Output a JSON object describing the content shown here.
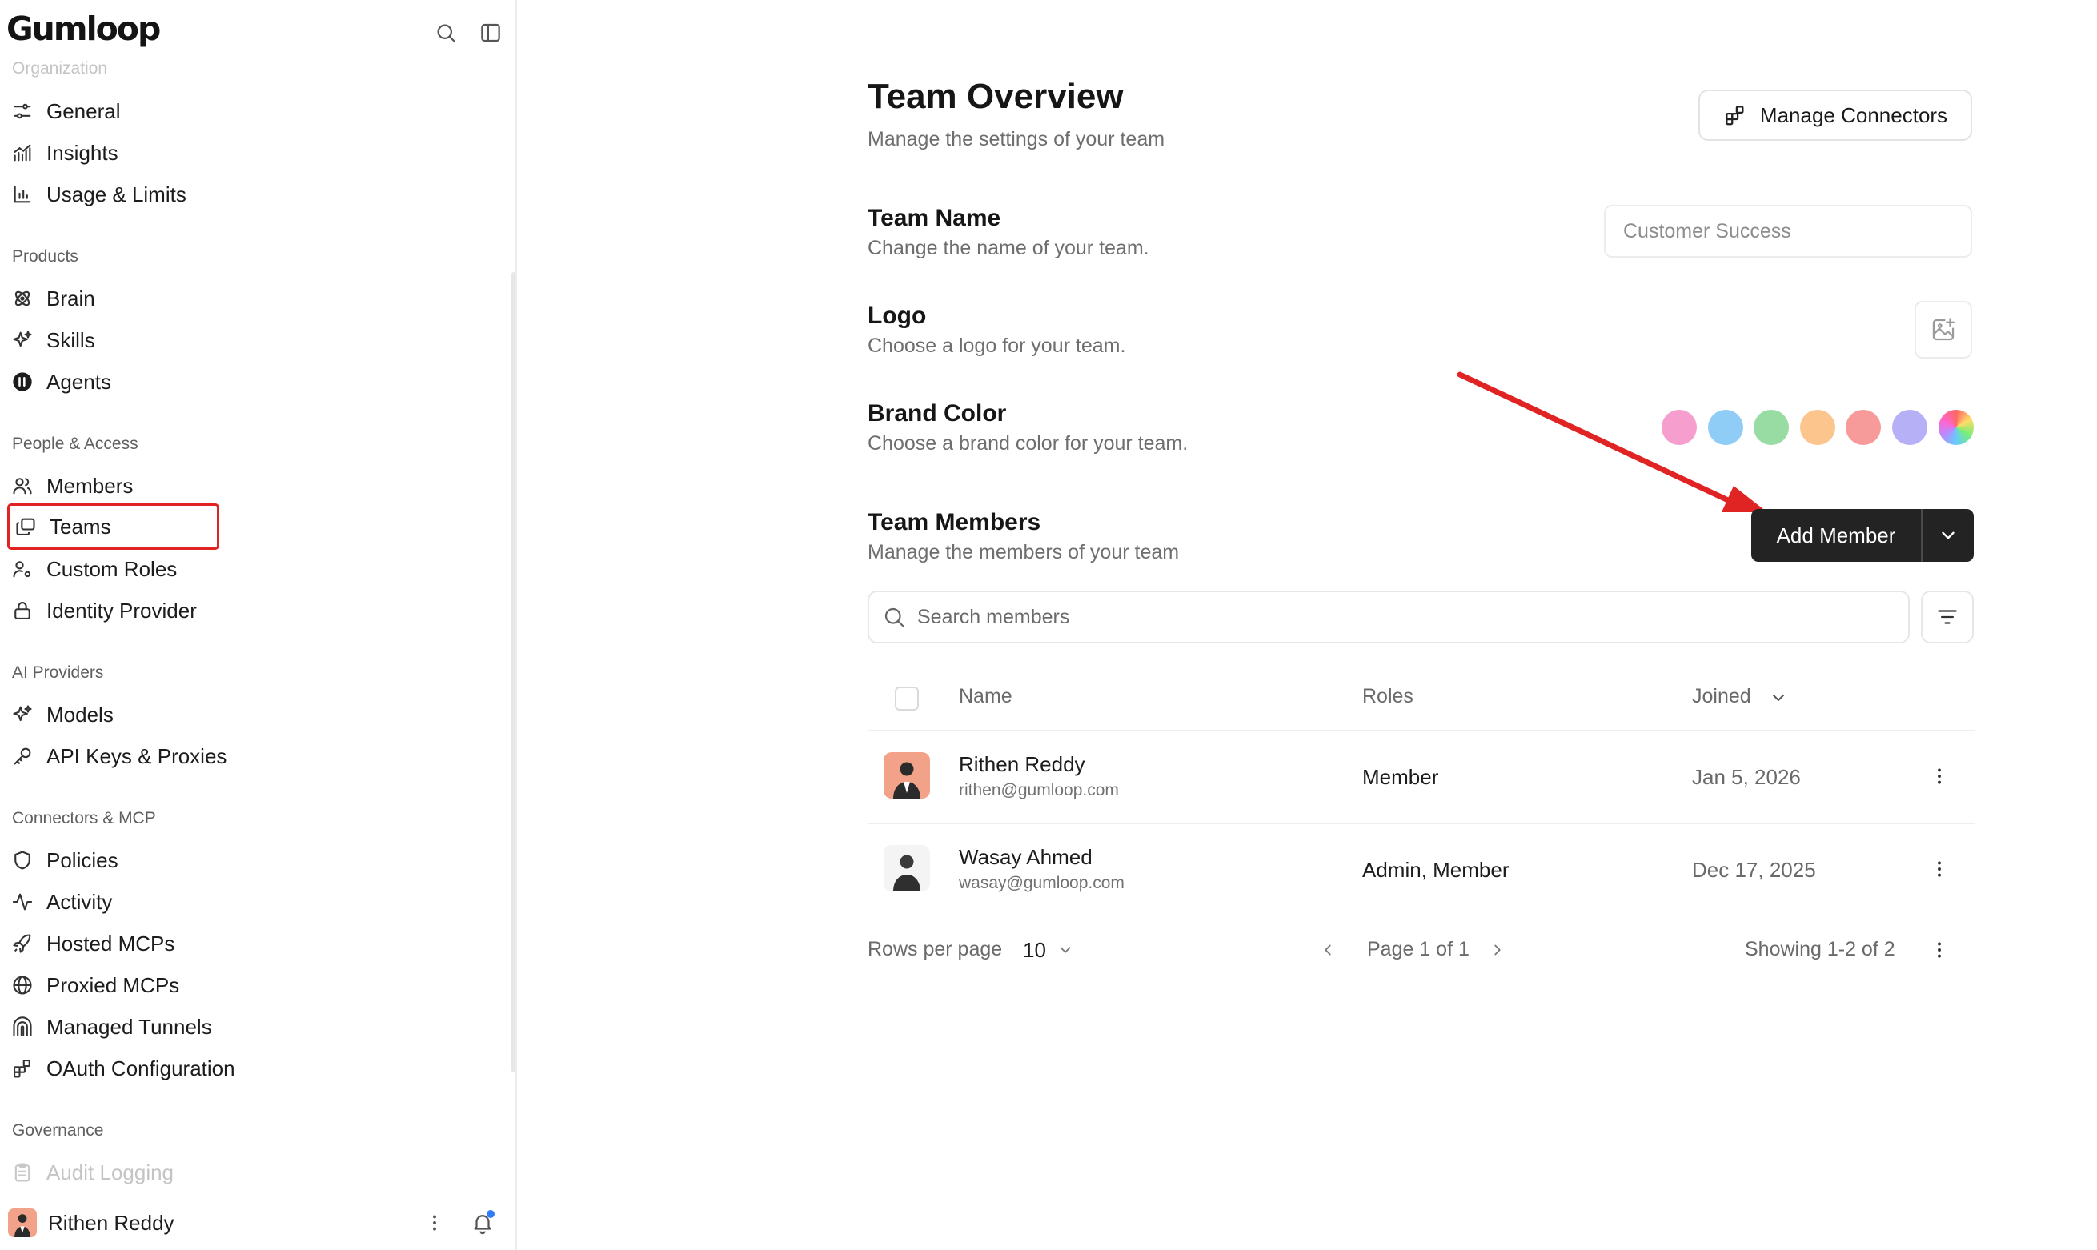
{
  "sidebar": {
    "brand": "Gumloop",
    "sections": {
      "organization": "Organization",
      "products": "Products",
      "people_access": "People & Access",
      "ai_providers": "AI Providers",
      "connectors_mcp": "Connectors & MCP",
      "governance": "Governance"
    },
    "items": {
      "general": "General",
      "insights": "Insights",
      "usage_limits": "Usage & Limits",
      "brain": "Brain",
      "skills": "Skills",
      "agents": "Agents",
      "members": "Members",
      "teams": "Teams",
      "custom_roles": "Custom Roles",
      "identity_provider": "Identity Provider",
      "models": "Models",
      "api_keys": "API Keys & Proxies",
      "policies": "Policies",
      "activity": "Activity",
      "hosted_mcps": "Hosted MCPs",
      "proxied_mcps": "Proxied MCPs",
      "managed_tunnels": "Managed Tunnels",
      "oauth_configuration": "OAuth Configuration",
      "audit_logging": "Audit Logging"
    },
    "selected_item": "Teams",
    "user": {
      "name": "Rithen Reddy"
    }
  },
  "header": {
    "title": "Team Overview",
    "subtitle": "Manage the settings of your team",
    "manage_connectors_label": "Manage Connectors"
  },
  "settings": {
    "team_name": {
      "title": "Team Name",
      "description": "Change the name of your team.",
      "value": "Customer Success"
    },
    "logo": {
      "title": "Logo",
      "description": "Choose a logo for your team."
    },
    "brand_color": {
      "title": "Brand Color",
      "description": "Choose a brand color for your team.",
      "swatches": [
        "#f69fcf",
        "#8fcdf7",
        "#98dca4",
        "#fbc58d",
        "#f79a9a",
        "#b6b0f6",
        "rainbow"
      ]
    }
  },
  "team_members": {
    "title": "Team Members",
    "description": "Manage the members of your team",
    "add_member_label": "Add Member",
    "search_placeholder": "Search members",
    "columns": {
      "name": "Name",
      "roles": "Roles",
      "joined": "Joined"
    },
    "rows": [
      {
        "name": "Rithen Reddy",
        "email": "rithen@gumloop.com",
        "roles": "Member",
        "joined": "Jan 5, 2026"
      },
      {
        "name": "Wasay Ahmed",
        "email": "wasay@gumloop.com",
        "roles": "Admin, Member",
        "joined": "Dec 17, 2025"
      }
    ],
    "pagination": {
      "rows_per_page_label": "Rows per page",
      "rows_per_page_value": "10",
      "page_label": "Page 1 of 1",
      "showing_label": "Showing 1-2 of 2"
    }
  },
  "colors": {
    "annotation_red": "#e02424",
    "primary_button": "#232323"
  }
}
